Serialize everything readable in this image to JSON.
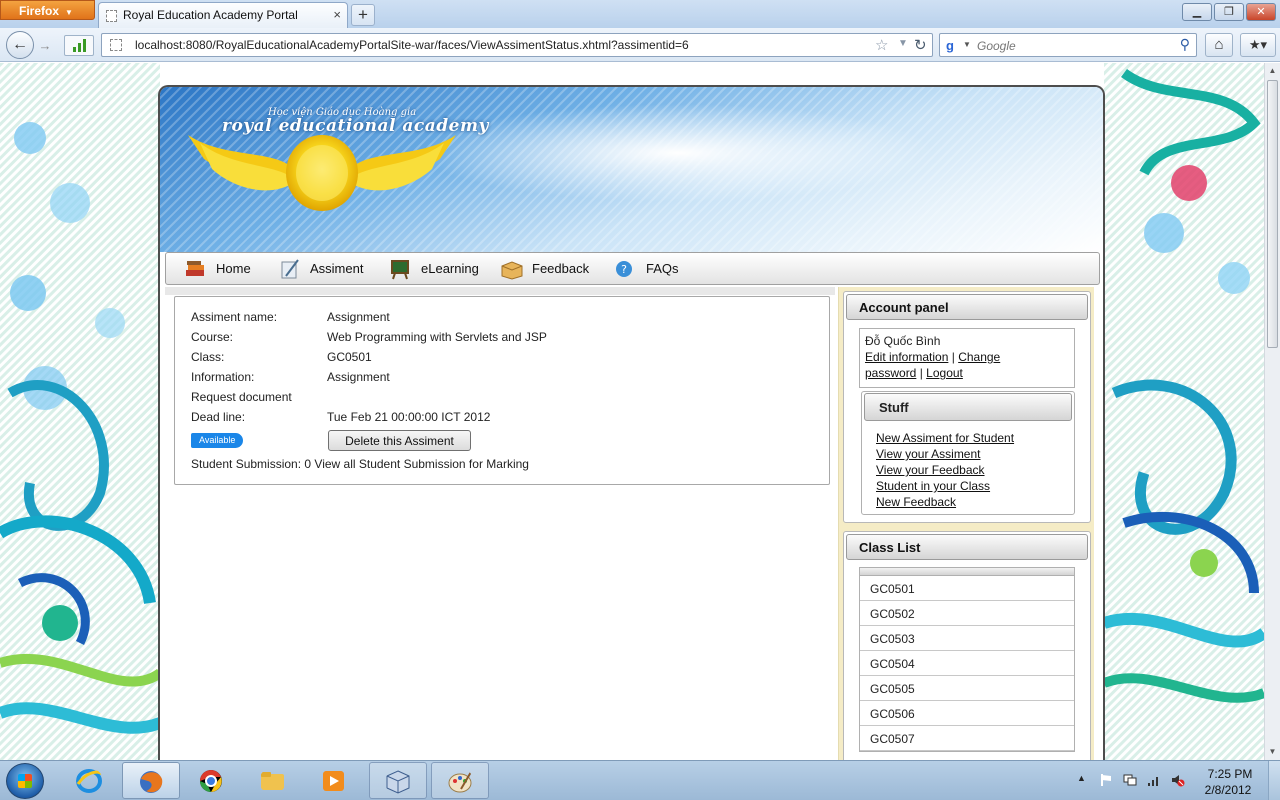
{
  "browser": {
    "menu_button": "Firefox",
    "tab_title": "Royal Education Academy Portal",
    "url": "localhost:8080/RoyalEducationalAcademyPortalSite-war/faces/ViewAssimentStatus.xhtml?assimentid=6",
    "search_placeholder": "Google"
  },
  "site": {
    "logo_subtitle": "Học viện Giáo dục Hoàng gia",
    "logo_title": "royal educational academy",
    "menu": [
      {
        "label": "Home",
        "icon": "books-icon"
      },
      {
        "label": "Assiment",
        "icon": "pen-paper-icon"
      },
      {
        "label": "eLearning",
        "icon": "chalkboard-icon"
      },
      {
        "label": "Feedback",
        "icon": "box-icon"
      },
      {
        "label": "FAQs",
        "icon": "help-icon"
      }
    ]
  },
  "assignment": {
    "name_label": "Assiment name:",
    "name_value": "Assignment",
    "course_label": "Course:",
    "course_value": "Web Programming with Servlets and JSP",
    "class_label": "Class:",
    "class_value": "GC0501",
    "information_label": "Information:",
    "information_value": "Assignment",
    "request_label": "Request document",
    "deadline_label": "Dead line:",
    "deadline_value": "Tue Feb 21 00:00:00 ICT 2012",
    "status_badge": "Available",
    "delete_button": "Delete this Assiment",
    "submission_text": "Student Submission: 0 View all Student Submission for Marking"
  },
  "account_panel": {
    "title": "Account panel",
    "user_name": "Đỗ Quốc Bình",
    "edit_link_1": "Edit information",
    "separator": "|",
    "change_link_1": "Change",
    "change_link_2": "password",
    "logout_link": "Logout"
  },
  "stuff": {
    "title": "Stuff",
    "links": [
      "New Assiment for Student",
      "View your Assiment",
      "View your Feedback",
      "Student in your Class",
      "New Feedback"
    ]
  },
  "class_list": {
    "title": "Class List",
    "items": [
      "GC0501",
      "GC0502",
      "GC0503",
      "GC0504",
      "GC0505",
      "GC0506",
      "GC0507"
    ]
  },
  "taskbar": {
    "time": "7:25 PM",
    "date": "2/8/2012"
  },
  "colors": {
    "firefox_orange": "#e0731a",
    "badge_blue": "#1a86e8",
    "right_column_bg": "#f5ecc6"
  }
}
